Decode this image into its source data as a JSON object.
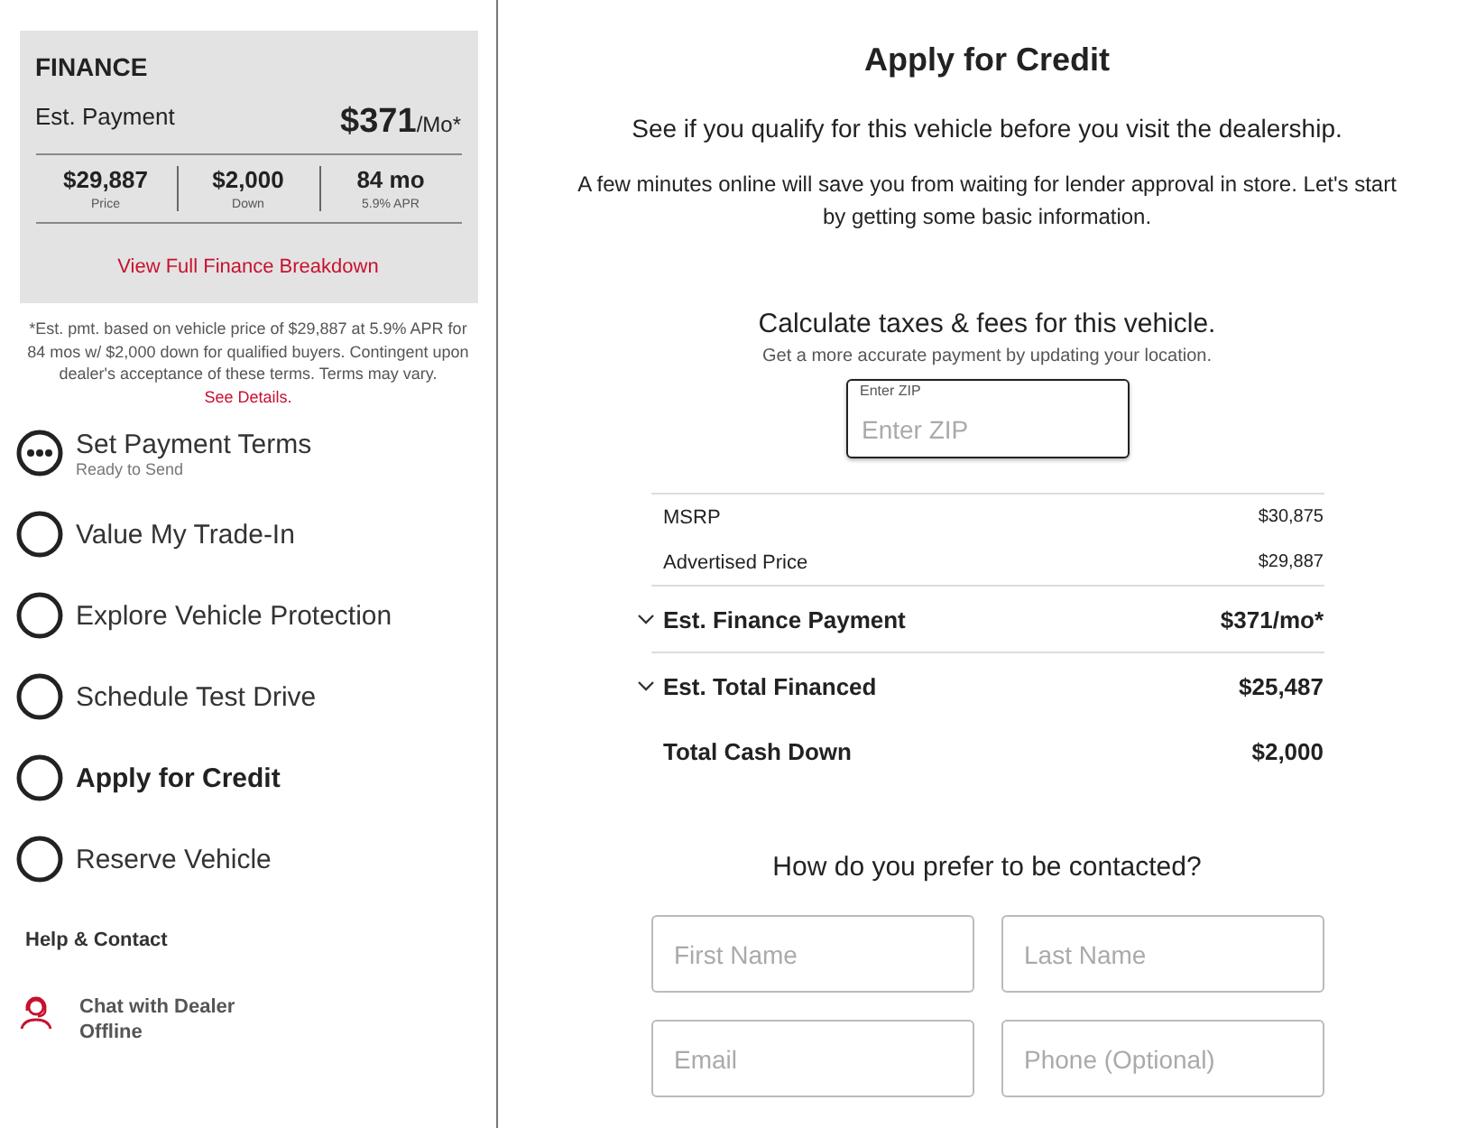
{
  "finance": {
    "title": "FINANCE",
    "payment_label": "Est. Payment",
    "payment_amount": "$371",
    "payment_unit": "/Mo*",
    "stats": [
      {
        "value": "$29,887",
        "caption": "Price"
      },
      {
        "value": "$2,000",
        "caption": "Down"
      },
      {
        "value": "84 mo",
        "caption": "5.9% APR"
      }
    ],
    "link": "View Full Finance Breakdown"
  },
  "disclaimer": {
    "text": "*Est. pmt. based on vehicle price of $29,887 at 5.9% APR for 84 mos w/ $2,000 down for qualified buyers. Contingent upon dealer's acceptance of these terms. Terms may vary.",
    "link": "See Details."
  },
  "steps": [
    {
      "label": "Set Payment Terms",
      "sublabel": "Ready to Send",
      "kind": "in_progress",
      "selected": false
    },
    {
      "label": "Value My Trade-In",
      "kind": "todo",
      "selected": false
    },
    {
      "label": "Explore Vehicle Protection",
      "kind": "todo",
      "selected": false
    },
    {
      "label": "Schedule Test Drive",
      "kind": "todo",
      "selected": false
    },
    {
      "label": "Apply for Credit",
      "kind": "todo",
      "selected": true
    },
    {
      "label": "Reserve Vehicle",
      "kind": "todo",
      "selected": false
    }
  ],
  "help": {
    "title": "Help & Contact",
    "chat_label": "Chat with Dealer",
    "chat_status": "Offline"
  },
  "main": {
    "title": "Apply for Credit",
    "subtitle": "See if you qualify for this vehicle before you visit the dealership.",
    "intro": "A few minutes online will save you from waiting for lender approval in store. Let's start by getting some basic information.",
    "taxes_title": "Calculate taxes & fees for this vehicle.",
    "taxes_hint": "Get a more accurate payment by updating your location.",
    "zip": {
      "label": "Enter ZIP",
      "placeholder": "Enter ZIP"
    },
    "summary": [
      {
        "label": "MSRP",
        "value": "$30,875",
        "kind": "minor",
        "expandable": false
      },
      {
        "label": "Advertised Price",
        "value": "$29,887",
        "kind": "minor",
        "expandable": false
      },
      {
        "label": "Est. Finance Payment",
        "value": "$371/mo*",
        "kind": "major",
        "expandable": true
      },
      {
        "label": "Est. Total Financed",
        "value": "$25,487",
        "kind": "major",
        "expandable": true
      },
      {
        "label": "Total Cash Down",
        "value": "$2,000",
        "kind": "major",
        "expandable": false
      }
    ],
    "contact_title": "How do you prefer to be contacted?",
    "fields": [
      {
        "placeholder": "First Name"
      },
      {
        "placeholder": "Last Name"
      },
      {
        "placeholder": "Email"
      },
      {
        "placeholder": "Phone (Optional)"
      }
    ]
  }
}
